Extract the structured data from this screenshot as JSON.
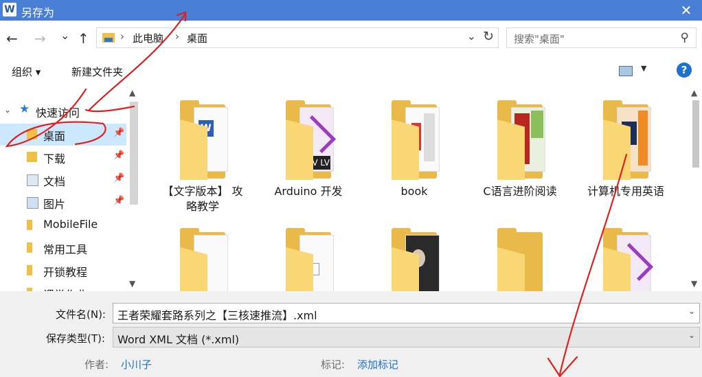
{
  "window": {
    "title": "另存为",
    "app_icon_letter": "W",
    "close_glyph": "✕"
  },
  "nav": {
    "back": "←",
    "forward": "→",
    "history": "⌄",
    "up": "↑",
    "breadcrumb": [
      "此电脑",
      "桌面"
    ],
    "breadcrumb_sep": "›",
    "address_dropdown": "⌄",
    "refresh": "↻",
    "search_placeholder": "搜索\"桌面\"",
    "search_icon": "⚲"
  },
  "toolbar": {
    "organize": "组织 ▾",
    "new_folder": "新建文件夹",
    "view_dropdown": "▼",
    "help": "?"
  },
  "sidebar": {
    "items": [
      {
        "label": "快速访问",
        "icon": "star-icon",
        "expandable": true
      },
      {
        "label": "桌面",
        "icon": "desktop-folder-icon",
        "pinned": true,
        "selected": true
      },
      {
        "label": "下载",
        "icon": "download-folder-icon",
        "pinned": true
      },
      {
        "label": "文档",
        "icon": "document-folder-icon",
        "pinned": true
      },
      {
        "label": "图片",
        "icon": "picture-folder-icon",
        "pinned": true
      },
      {
        "label": "MobileFile",
        "icon": "folder-icon"
      },
      {
        "label": "常用工具",
        "icon": "folder-icon"
      },
      {
        "label": "开锁教程",
        "icon": "folder-icon"
      },
      {
        "label": "课堂作业",
        "icon": "folder-icon"
      }
    ],
    "expand_glyph": "⌄",
    "pin_glyph": "📌",
    "scroll_up": "▲",
    "scroll_down": "▼"
  },
  "content": {
    "folders": [
      {
        "name": "【文字版本】 攻略教学",
        "line1": "【文字版本】 攻",
        "line2": "略教学"
      },
      {
        "name": "Arduino 开发",
        "line1": "Arduino 开发",
        "line2": ""
      },
      {
        "name": "book",
        "line1": "book",
        "line2": ""
      },
      {
        "name": "C语言进阶阅读",
        "line1": "C语言进阶阅读",
        "line2": ""
      },
      {
        "name": "计算机专用英语",
        "line1": "计算机专用英语",
        "line2": ""
      },
      {
        "name": "",
        "line1": "",
        "line2": ""
      },
      {
        "name": "",
        "line1": "",
        "line2": ""
      },
      {
        "name": "",
        "line1": "",
        "line2": ""
      },
      {
        "name": "",
        "line1": "",
        "line2": ""
      },
      {
        "name": "",
        "line1": "",
        "line2": ""
      }
    ],
    "scroll_up": "▲",
    "scroll_down": "▼"
  },
  "save": {
    "filename_label": "文件名(N):",
    "filename_value": "王者荣耀套路系列之【三核速推流】.xml",
    "type_label": "保存类型(T):",
    "type_value": "Word XML 文档 (*.xml)",
    "dropdown": "⌄",
    "author_label": "作者:",
    "author_value": "小川子",
    "tags_label": "标记:",
    "tags_value": "添加标记"
  },
  "colors": {
    "titlebar": "#4a7fd6",
    "selection": "#cce8ff",
    "link": "#1f6fd1",
    "annotation": "#e02020"
  }
}
